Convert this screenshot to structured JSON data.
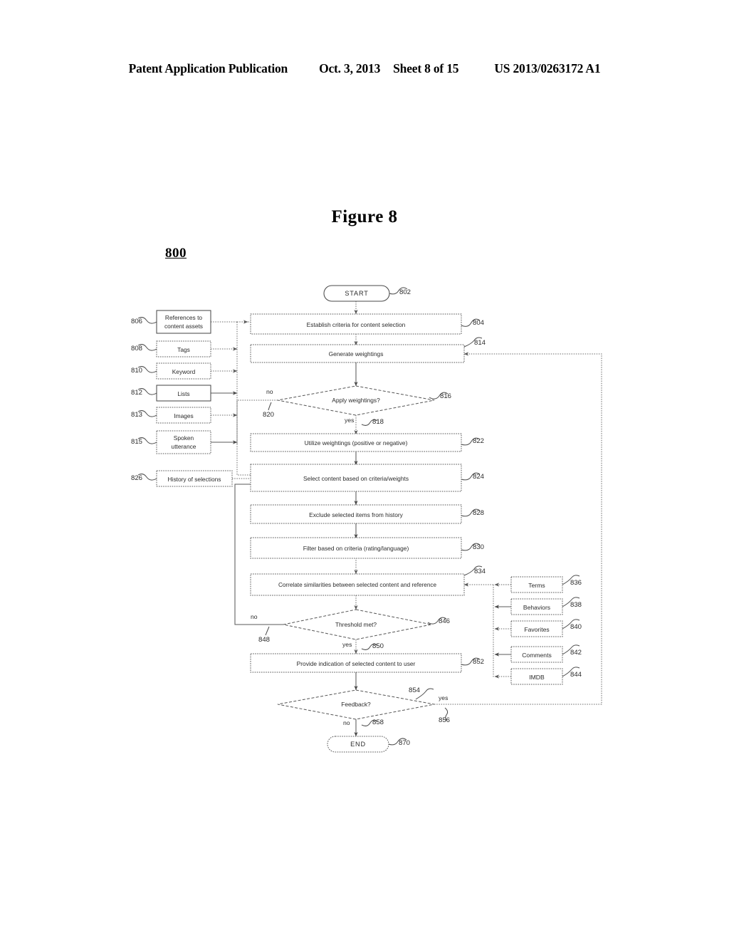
{
  "header": {
    "publication": "Patent Application Publication",
    "date": "Oct. 3, 2013",
    "sheet": "Sheet 8 of 15",
    "patent_number": "US 2013/0263172 A1"
  },
  "figure": {
    "title": "Figure 8",
    "reference": "800"
  },
  "flowchart": {
    "terminators": {
      "start": {
        "label": "START",
        "ref": "802"
      },
      "end": {
        "label": "END",
        "ref": "870"
      }
    },
    "process_steps": [
      {
        "label": "Establish criteria for content selection",
        "ref": "804"
      },
      {
        "label": "Generate weightings",
        "ref": "814"
      },
      {
        "label": "Utilize weightings (positive or negative)",
        "ref": "822"
      },
      {
        "label": "Select content based on criteria/weights",
        "ref": "824"
      },
      {
        "label": "Exclude selected items from history",
        "ref": "828"
      },
      {
        "label": "Filter based on criteria (rating/language)",
        "ref": "830"
      },
      {
        "label": "Correlate similarities between selected content and reference",
        "ref": "834"
      },
      {
        "label": "Provide indication of selected content to user",
        "ref": "852"
      }
    ],
    "decisions": [
      {
        "label": "Apply weightings?",
        "ref": "816",
        "no_label": "no",
        "no_ref": "820",
        "yes_label": "yes",
        "yes_ref": "818"
      },
      {
        "label": "Threshold met?",
        "ref": "846",
        "no_label": "no",
        "no_ref": "848",
        "yes_label": "yes",
        "yes_ref": "850"
      },
      {
        "label": "Feedback?",
        "ref": "854",
        "no_label": "no",
        "no_ref": "858",
        "yes_label": "yes",
        "yes_ref": "856"
      }
    ],
    "inputs_left": [
      {
        "label_line1": "References to",
        "label_line2": "content assets",
        "ref": "806"
      },
      {
        "label_line1": "Tags",
        "label_line2": "",
        "ref": "808"
      },
      {
        "label_line1": "Keyword",
        "label_line2": "",
        "ref": "810"
      },
      {
        "label_line1": "Lists",
        "label_line2": "",
        "ref": "812"
      },
      {
        "label_line1": "Images",
        "label_line2": "",
        "ref": "813"
      },
      {
        "label_line1": "Spoken",
        "label_line2": "utterance",
        "ref": "815"
      },
      {
        "label_line1": "History of selections",
        "label_line2": "",
        "ref": "826"
      }
    ],
    "inputs_right": [
      {
        "label": "Terms",
        "ref": "836"
      },
      {
        "label": "Behaviors",
        "ref": "838"
      },
      {
        "label": "Favorites",
        "ref": "840"
      },
      {
        "label": "Comments",
        "ref": "842"
      },
      {
        "label": "IMDB",
        "ref": "844"
      }
    ]
  }
}
